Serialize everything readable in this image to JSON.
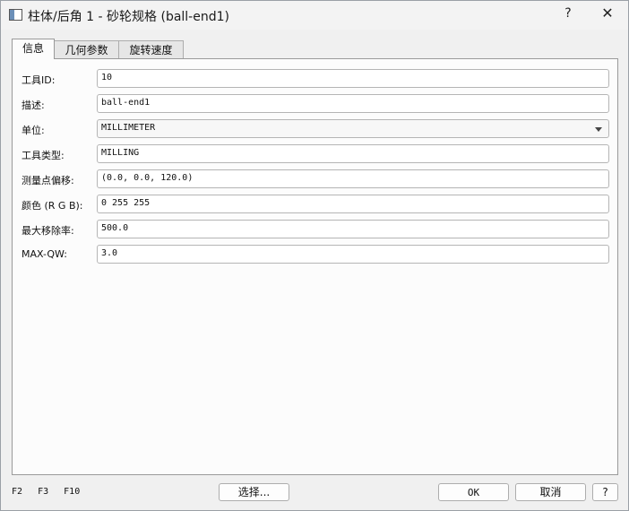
{
  "window": {
    "title": "柱体/后角 1 - 砂轮规格 (ball-end1)",
    "help_glyph": "?",
    "close_glyph": "✕"
  },
  "tabs": [
    {
      "label": "信息",
      "active": true
    },
    {
      "label": "几何参数",
      "active": false
    },
    {
      "label": "旋转速度",
      "active": false
    }
  ],
  "fields": [
    {
      "label": "工具ID:",
      "value": "10",
      "kind": "text"
    },
    {
      "label": "描述:",
      "value": "ball-end1",
      "kind": "text"
    },
    {
      "label": "单位:",
      "value": "MILLIMETER",
      "kind": "select"
    },
    {
      "label": "工具类型:",
      "value": "MILLING",
      "kind": "text"
    },
    {
      "label": "测量点偏移:",
      "value": "(0.0, 0.0, 120.0)",
      "kind": "text"
    },
    {
      "label": "颜色 (R G B):",
      "value": "0 255 255",
      "kind": "text"
    },
    {
      "label": "最大移除率:",
      "value": "500.0",
      "kind": "text"
    },
    {
      "label": "MAX-QW:",
      "value": "3.0",
      "kind": "text"
    }
  ],
  "footer": {
    "fkeys": [
      "F2",
      "F3",
      "F10"
    ],
    "select_button": "选择...",
    "ok_button": "OK",
    "cancel_button": "取消",
    "help_button": "?"
  },
  "colors": {
    "window_bg": "#f0f0f0",
    "panel_bg": "#fcfcfc",
    "border": "#9a9a9a",
    "accent_icon": "#6b8fb8"
  }
}
